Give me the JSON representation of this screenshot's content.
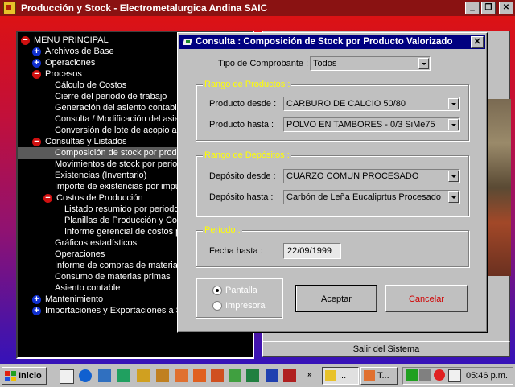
{
  "app": {
    "title": "Producción y Stock - Electrometalurgica Andina SAIC",
    "window_buttons": [
      "_",
      "❐",
      "✕"
    ]
  },
  "tree": {
    "items": [
      {
        "label": "MENU PRINCIPAL",
        "toggle": "-"
      },
      {
        "label": "Archivos de Base",
        "toggle": "+"
      },
      {
        "label": "Operaciones",
        "toggle": "+"
      },
      {
        "label": "Procesos",
        "toggle": "-"
      },
      {
        "label": "Cálculo de Costos"
      },
      {
        "label": "Cierre del periodo de trabajo"
      },
      {
        "label": "Generación del asiento contable"
      },
      {
        "label": "Consulta / Modificación del asien"
      },
      {
        "label": "Conversión de lote de acopio a l"
      },
      {
        "label": "Consultas y Listados",
        "toggle": "-"
      },
      {
        "label": "Composición de stock por produ",
        "selected": true
      },
      {
        "label": "Movimientos de stock por period"
      },
      {
        "label": "Existencias (Inventario)"
      },
      {
        "label": "Importe de existencias por imput"
      },
      {
        "label": "Costos de Producción",
        "toggle": "-"
      },
      {
        "label": "Listado resumido por periodo"
      },
      {
        "label": "Planillas de Producción y Con"
      },
      {
        "label": "Informe gerencial de costos p"
      },
      {
        "label": "Gráficos estadísticos"
      },
      {
        "label": "Operaciones"
      },
      {
        "label": "Informe de compras de materias"
      },
      {
        "label": "Consumo de materias primas"
      },
      {
        "label": "Asiento contable"
      },
      {
        "label": "Mantenimiento",
        "toggle": "+"
      },
      {
        "label": "Importaciones y Exportaciones a S",
        "toggle": "+"
      }
    ]
  },
  "exit_button": {
    "label": "Salir del Sistema"
  },
  "dialog": {
    "title": "Consulta : Composición de Stock por Producto Valorizado",
    "close_label": "✕",
    "tipo": {
      "label": "Tipo de Comprobante :",
      "value": "Todos"
    },
    "productos": {
      "title": "Rango de Productos :",
      "desde_label": "Producto desde :",
      "desde_value": "CARBURO DE CALCIO 50/80",
      "hasta_label": "Producto hasta :",
      "hasta_value": "POLVO EN TAMBORES - 0/3 SiMe75"
    },
    "depositos": {
      "title": "Rango de Depósitos :",
      "desde_label": "Depósito desde :",
      "desde_value": "CUARZO COMUN PROCESADO",
      "hasta_label": "Depósito hasta :",
      "hasta_value": "Carbón de Leña Eucaliprtus Procesado"
    },
    "periodo": {
      "title": "Período :",
      "fecha_label": "Fecha hasta :",
      "fecha_value": "22/09/1999"
    },
    "output": {
      "pantalla": "Pantalla",
      "impresora": "Impresora",
      "selected": "Pantalla"
    },
    "accept_label": "Aceptar",
    "cancel_label": "Cancelar"
  },
  "taskbar": {
    "start_label": "Inicio",
    "overflow_label": "»",
    "tasks": [
      {
        "label": "..."
      },
      {
        "label": "T..."
      }
    ],
    "clock": "05:46 p.m."
  },
  "colors": {
    "accent_titlebar": "#000080",
    "group_title": "#ffff00",
    "cancel_text": "#d00000",
    "tree_bg": "#000000",
    "tree_selected": "#5a5a5a"
  }
}
